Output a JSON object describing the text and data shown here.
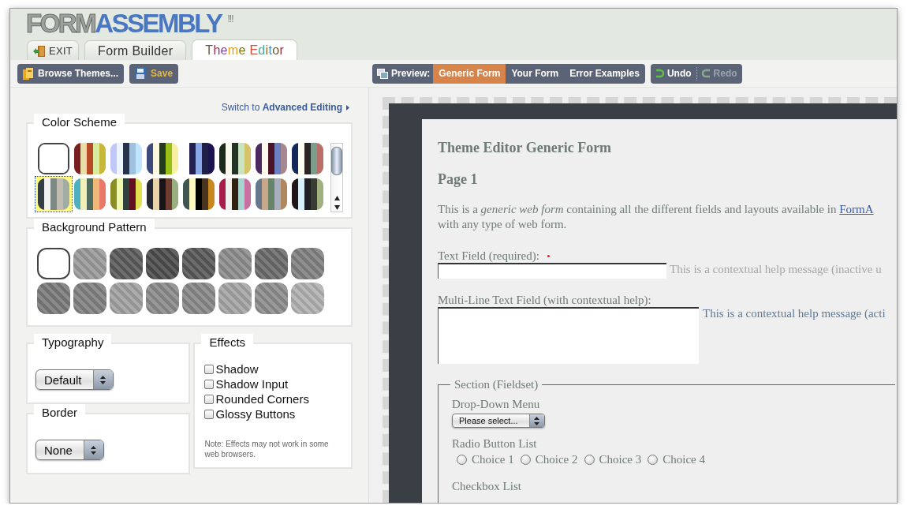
{
  "logo": {
    "part_1": "FORM",
    "part_2": "ASSEMBLY",
    "mark": "!!!"
  },
  "tabs": [
    {
      "label": "EXIT",
      "kind": "exit",
      "selected": false
    },
    {
      "label": "Form Builder",
      "kind": "plain",
      "selected": false
    },
    {
      "label": "Theme Editor",
      "kind": "plain",
      "selected": true
    }
  ],
  "toolbar": {
    "browse": "Browse Themes...",
    "save": "Save"
  },
  "preview": {
    "label": "Preview:",
    "options": [
      {
        "label": "Generic Form",
        "selected": true
      },
      {
        "label": "Your Form",
        "selected": false
      },
      {
        "label": "Error Examples",
        "selected": false
      }
    ]
  },
  "history": [
    {
      "label": "Undo",
      "kind": "undo",
      "disabled": false
    },
    {
      "label": "Redo",
      "kind": "redo",
      "disabled": true
    }
  ],
  "switch_link": "Switch to **Advanced Editing**",
  "color_scheme": {
    "title": "Color Scheme",
    "swatches": [
      {
        "stripes": [
          {
            "color": "#ffffff"
          }
        ],
        "selected": false
      },
      {
        "stripes": [
          {
            "color": "#7a1f1f"
          },
          {
            "color": "#e8dca8"
          },
          {
            "color": "#b84a25"
          },
          {
            "color": "#d8eca0"
          },
          {
            "color": "#c8b83a"
          }
        ],
        "selected": false
      },
      {
        "stripes": [
          {
            "color": "#c0c8f8"
          },
          {
            "color": "#eef4fc"
          },
          {
            "color": "#283248"
          },
          {
            "color": "#a0c0e0"
          },
          {
            "color": "#c0e4fc"
          }
        ],
        "selected": false
      },
      {
        "stripes": [
          {
            "color": "#3c4a7c"
          },
          {
            "color": "#fcf8e0"
          },
          {
            "color": "#243a1c"
          },
          {
            "color": "#98c018"
          },
          {
            "color": "#f8f0a0"
          }
        ],
        "selected": false
      },
      {
        "stripes": [
          {
            "color": "#ffffff"
          },
          {
            "color": "#242050"
          },
          {
            "color": "#88a8e8"
          },
          {
            "color": "#1e2048"
          },
          {
            "color": "#1c1450"
          }
        ],
        "selected": false
      },
      {
        "stripes": [
          {
            "color": "#1c2a1c"
          },
          {
            "color": "#f8f8ec"
          },
          {
            "color": "#243424"
          },
          {
            "color": "#c8e4c0"
          },
          {
            "color": "#d4c468"
          }
        ],
        "selected": false
      },
      {
        "stripes": [
          {
            "color": "#4a2a60"
          },
          {
            "color": "#fcfaec"
          },
          {
            "color": "#4a1428"
          },
          {
            "color": "#6a80c0"
          },
          {
            "color": "#a88890"
          }
        ],
        "selected": false
      },
      {
        "stripes": [
          {
            "color": "#14285c"
          },
          {
            "color": "#fcfcf0"
          },
          {
            "color": "#2c2424"
          },
          {
            "color": "#7c9c8c"
          },
          {
            "color": "#b87068"
          }
        ],
        "selected": false
      },
      {
        "stripes": [
          {
            "color": "#343c44"
          },
          {
            "color": "#f0f0f0"
          },
          {
            "color": "#7c8884"
          },
          {
            "color": "#c0bcb0"
          },
          {
            "color": "#a0aca4"
          }
        ],
        "selected": true
      },
      {
        "stripes": [
          {
            "color": "#50b0c0"
          },
          {
            "color": "#f0f0b8"
          },
          {
            "color": "#506c60"
          },
          {
            "color": "#f0b878"
          },
          {
            "color": "#e87868"
          }
        ],
        "selected": false
      },
      {
        "stripes": [
          {
            "color": "#8c8c24"
          },
          {
            "color": "#f0f8b0"
          },
          {
            "color": "#30403c"
          },
          {
            "color": "#601020"
          },
          {
            "color": "#e0e050"
          }
        ],
        "selected": false
      },
      {
        "stripes": [
          {
            "color": "#242834"
          },
          {
            "color": "#e8d4a8"
          },
          {
            "color": "#181418"
          },
          {
            "color": "#6c3c30"
          },
          {
            "color": "#98b080"
          }
        ],
        "selected": false
      },
      {
        "stripes": [
          {
            "color": "#405450"
          },
          {
            "color": "#fcf8c0"
          },
          {
            "color": "#000000"
          },
          {
            "color": "#483420"
          },
          {
            "color": "#c88820"
          }
        ],
        "selected": false
      },
      {
        "stripes": [
          {
            "color": "#a81c4c"
          },
          {
            "color": "#f0f0f0"
          },
          {
            "color": "#302010"
          },
          {
            "color": "#a8d4d0"
          },
          {
            "color": "#c870a0"
          }
        ],
        "selected": false
      },
      {
        "stripes": [
          {
            "color": "#68788c"
          },
          {
            "color": "#c8a888"
          },
          {
            "color": "#688468"
          },
          {
            "color": "#a8b0c0"
          },
          {
            "color": "#b08860"
          }
        ],
        "selected": false
      },
      {
        "stripes": [
          {
            "color": "#201818"
          },
          {
            "color": "#d8f0fc"
          },
          {
            "color": "#202024"
          },
          {
            "color": "#383c34"
          },
          {
            "color": "#a0b080"
          }
        ],
        "selected": false
      }
    ]
  },
  "background_pattern": {
    "title": "Background Pattern",
    "patterns": [
      {
        "color": "#ffffff",
        "selected": false
      },
      {
        "color": "#9a9a9a",
        "selected": false
      },
      {
        "color": "#5a5a5a",
        "selected": false
      },
      {
        "color": "#4c4c4c",
        "selected": false
      },
      {
        "color": "#585858",
        "selected": false
      },
      {
        "color": "#8c8c8c",
        "selected": false
      },
      {
        "color": "#6a6a6a",
        "selected": false
      },
      {
        "color": "#808080",
        "selected": false
      },
      {
        "color": "#7a7a7a",
        "selected": false
      },
      {
        "color": "#808080",
        "selected": false
      },
      {
        "color": "#a0a0a0",
        "selected": false
      },
      {
        "color": "#8a8a8a",
        "selected": false
      },
      {
        "color": "#888888",
        "selected": false
      },
      {
        "color": "#a4a4a4",
        "selected": false
      },
      {
        "color": "#8c8c8c",
        "selected": false
      },
      {
        "color": "#b0b0b0",
        "selected": false
      }
    ]
  },
  "typography": {
    "title": "Typography",
    "value": "Default"
  },
  "border": {
    "title": "Border",
    "value": "None"
  },
  "effects": {
    "title": "Effects",
    "options": [
      {
        "label": "Shadow",
        "checked": false
      },
      {
        "label": "Shadow Input",
        "checked": false
      },
      {
        "label": "Rounded Corners",
        "checked": false
      },
      {
        "label": "Glossy Buttons",
        "checked": false
      }
    ],
    "note": "Note: Effects may not work in some web browsers."
  },
  "form": {
    "title": "Theme Editor Generic Form",
    "page": "Page 1",
    "intro": "This is a *generic web form* containing all the different fields and layouts available in",
    "intro_link": "FormA",
    "intro_end": "with any type of web form.",
    "fields": [
      {
        "kind": "text",
        "label": "Text Field (required):",
        "required": true,
        "help": "This is a contextual help message (inactive u",
        "help_active": false
      },
      {
        "kind": "textarea",
        "label": "Multi-Line Text Field (with contextual help):",
        "required": false,
        "help": "This is a contextual help message (acti",
        "help_active": true
      }
    ],
    "section": {
      "legend": "Section (Fieldset)",
      "dropdown_label": "Drop-Down Menu",
      "dropdown_value": "Please select...",
      "radio_label": "Radio Button List",
      "choices": [
        {
          "label": "Choice 1",
          "selected": false
        },
        {
          "label": "Choice 2",
          "selected": false
        },
        {
          "label": "Choice 3",
          "selected": false
        },
        {
          "label": "Choice 4",
          "selected": false
        }
      ],
      "checkbox_label": "Checkbox List"
    }
  }
}
